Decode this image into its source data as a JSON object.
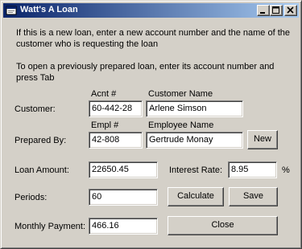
{
  "window": {
    "title": "Watt's A Loan",
    "controls": {
      "minimize": "minimize",
      "maximize": "maximize",
      "close": "close"
    }
  },
  "instructions": {
    "line1": "If this is a new loan, enter a new account number and the name of the customer who is requesting the loan",
    "line2": "To open a previously prepared loan, enter its account number and press Tab"
  },
  "customer": {
    "label": "Customer:",
    "acnt_header": "Acnt #",
    "name_header": "Customer Name",
    "account_number": "60-442-28",
    "customer_name": "Arlene Simson"
  },
  "prepared_by": {
    "label": "Prepared By:",
    "empl_header": "Empl #",
    "name_header": "Employee Name",
    "employee_number": "42-808",
    "employee_name": "Gertrude Monay",
    "new_button": "New"
  },
  "loan": {
    "amount_label": "Loan Amount:",
    "amount": "22650.45",
    "rate_label": "Interest Rate:",
    "rate": "8.95",
    "rate_suffix": "%",
    "periods_label": "Periods:",
    "periods": "60",
    "payment_label": "Monthly Payment:",
    "payment": "466.16"
  },
  "buttons": {
    "calculate": "Calculate",
    "save": "Save",
    "close": "Close"
  }
}
